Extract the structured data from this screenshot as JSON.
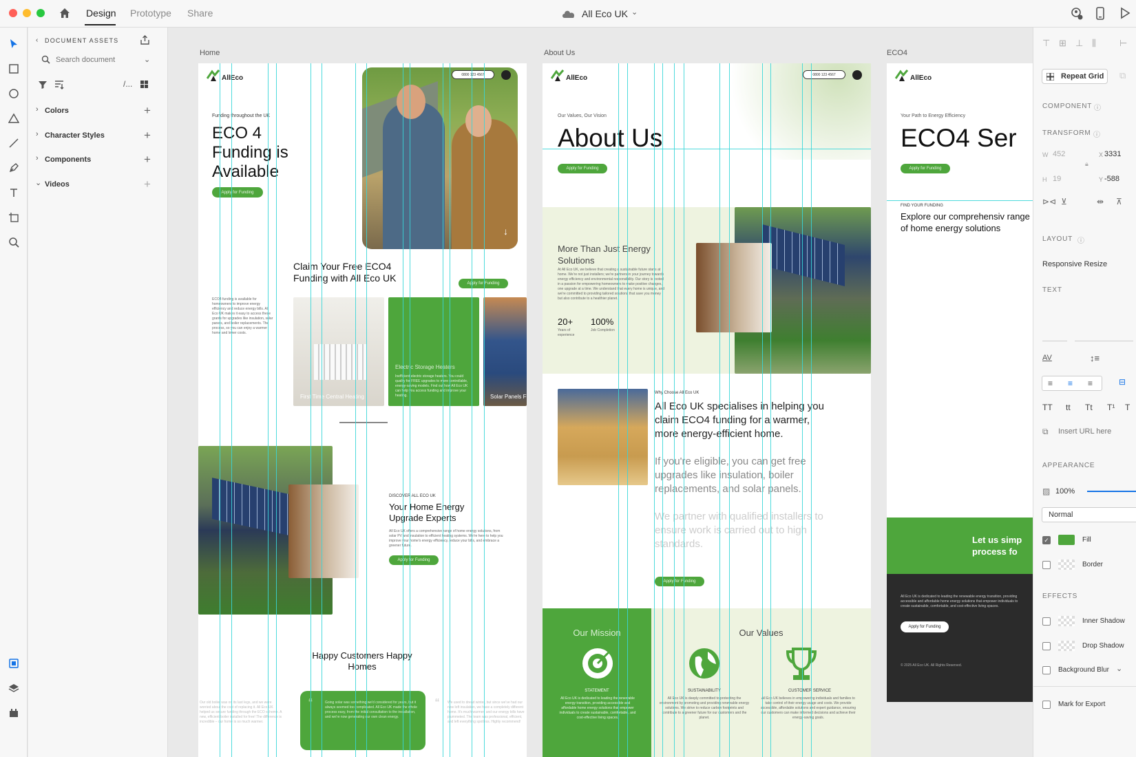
{
  "window": {
    "doc_title": "All Eco UK",
    "tabs": [
      "Design",
      "Prototype",
      "Share"
    ]
  },
  "assets": {
    "header": "DOCUMENT ASSETS",
    "search_placeholder": "Search document",
    "sections": [
      "Colors",
      "Character Styles",
      "Components",
      "Videos"
    ]
  },
  "canvas": {
    "artboards": [
      "Home",
      "About Us",
      "ECO4"
    ]
  },
  "home": {
    "phone": "0800 123 4567",
    "eyebrow": "Funding throughout the UK",
    "hero_title": "ECO 4 Funding is Available",
    "apply": "Apply for Funding",
    "claim_title": "Claim Your Free ECO4 Funding with All Eco UK",
    "claim_body": "ECO4 funding is available for homeowners to improve energy efficiency and reduce energy bills. All Eco UK makes it easy to access these grants for upgrades like insulation, solar panels, and boiler replacements. The process, so you can enjoy a warmer home and lower costs.",
    "cards": [
      "First Time Central Heating",
      "Electric Storage Heaters",
      "Solar Panels Fund"
    ],
    "card2_body": "Inefficient electric storage heaters. You could qualify for FREE upgrades to more controllable, energy-saving models. Find out how All Eco UK can help you access funding and improve your heating.",
    "discover_eyebrow": "DISCOVER ALL ECO UK",
    "discover_title": "Your Home Energy Upgrade Experts",
    "discover_body": "All Eco UK offers a comprehensive range of home energy solutions, from solar PV and insulation to efficient heating systems. We're here to help you improve your home's energy efficiency, reduce your bills, and embrace a greener future.",
    "happy_title": "Happy Customers Happy Homes",
    "testimonial_left": "Our old boiler was on its last legs, and we were worried about the cost of replacing it. All Eco UK helped us secure funding through the ECO scheme. A new, efficient boiler installed for free! The difference is incredible – our home is so much warmer.",
    "testimonial_mid": "Going solar was something we'd considered for years, but it always seemed too complicated. All Eco UK made the whole process easy, from the initial consultation to the installation, and we're now generating our own clean energy.",
    "testimonial_right": "We used to dread winter, but since we've had our new loft insulation, we have a completely different home. It's much warmer, and our energy bills have plummeted. The team was professional, efficient, and left everything spotless. Highly recommend!"
  },
  "about": {
    "phone": "0800 123 4567",
    "eyebrow": "Our Values, Our Vision",
    "title": "About Us",
    "apply": "Apply for Funding",
    "more_title": "More Than Just Energy Solutions",
    "more_body": "At All Eco UK, we believe that creating a sustainable future starts at home. We're not just installers; we're partners in your journey towards energy efficiency and environmental responsibility. Our story is rooted in a passion for empowering homeowners to make positive changes, one upgrade at a time. We understand that every home is unique, and we're committed to providing tailored solutions that save you money but also contribute to a healthier planet.",
    "stats": [
      {
        "value": "20+",
        "label": "Years of experience"
      },
      {
        "value": "100%",
        "label": "Job Completion"
      }
    ],
    "why_eyebrow": "Why Choose All Eco UK",
    "why_p1": "All Eco UK specialises in helping you claim ECO4 funding for a warmer, more energy-efficient home.",
    "why_p2": "If you're eligible, you can get free upgrades like insulation, boiler replacements, and solar panels.",
    "why_p3": "We partner with qualified installers to ensure work is carried out to high standards.",
    "mission_title": "Our Mission",
    "values_title": "Our Values",
    "pillars": [
      {
        "title": "STATEMENT",
        "body": "All Eco UK is dedicated to leading the renewable energy transition, providing accessible and affordable home energy solutions that empower individuals to create sustainable, comfortable, and cost-effective living spaces."
      },
      {
        "title": "SUSTAINABILITY",
        "body": "All Eco UK is deeply committed to protecting the environment by promoting and providing renewable energy solutions. We strive to reduce carbon footprints and contribute to a greener future for our customers and the planet."
      },
      {
        "title": "CUSTOMER SERVICE",
        "body": "All Eco UK believes in empowering individuals and families to take control of their energy usage and costs. We provide accessible, affordable solutions and expert guidance, ensuring our customers can make informed decisions and achieve their energy-saving goals."
      }
    ]
  },
  "eco4": {
    "eyebrow": "Your Path to Energy Efficiency",
    "title": "ECO4 Ser",
    "apply": "Apply for Funding",
    "find_eyebrow": "FIND YOUR FUNDING",
    "find_title": "Explore our comprehensiv range of home energy solutions",
    "cta": "Let us simp process fo",
    "footer_body": "All Eco UK is dedicated to leading the renewable energy transition, providing accessible and affordable home energy solutions that empower individuals to create sustainable, comfortable, and cost-effective living spaces.",
    "footer_apply": "Apply for Funding",
    "copyright": "© 2025 All Eco UK. All Rights Reserved."
  },
  "logo": "AllEco",
  "props": {
    "repeat_grid": "Repeat Grid",
    "component_label": "COMPONENT",
    "transform_label": "TRANSFORM",
    "w_label": "W",
    "w": "452",
    "x_label": "X",
    "x": "3331",
    "h_label": "H",
    "h": "19",
    "y_label": "Y",
    "y": "-588",
    "layout_label": "LAYOUT",
    "responsive": "Responsive Resize",
    "text_label": "TEXT",
    "case_opts": [
      "TT",
      "tt",
      "Tt",
      "T¹",
      "T"
    ],
    "url_placeholder": "Insert URL here",
    "appearance_label": "APPEARANCE",
    "opacity": "100%",
    "blend": "Normal",
    "fill": "Fill",
    "border": "Border",
    "effects_label": "EFFECTS",
    "inner_shadow": "Inner Shadow",
    "drop_shadow": "Drop Shadow",
    "background_blur": "Background Blur",
    "export": "Mark for Export"
  },
  "colors": {
    "brand_green": "#4ea63c",
    "accent_blue": "#1473e6",
    "guide": "#38d6d8"
  }
}
